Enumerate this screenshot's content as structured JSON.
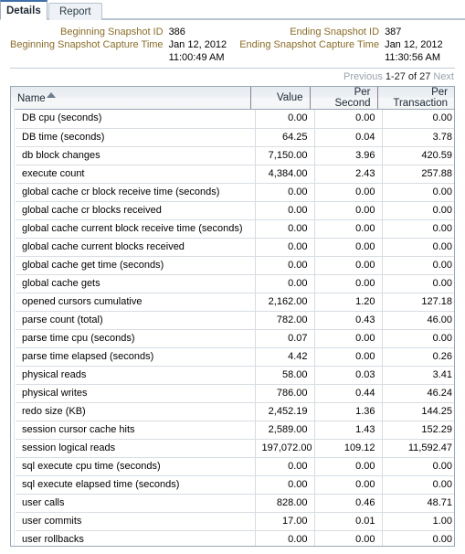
{
  "tabs": [
    {
      "label": "Details",
      "active": true
    },
    {
      "label": "Report",
      "active": false
    }
  ],
  "summary": {
    "beginning_snapshot_id_label": "Beginning Snapshot ID",
    "beginning_snapshot_id_value": "386",
    "beginning_capture_time_label": "Beginning Snapshot Capture Time",
    "beginning_capture_time_date": "Jan 12, 2012",
    "beginning_capture_time_clock": "11:00:49 AM",
    "ending_snapshot_id_label": "Ending Snapshot ID",
    "ending_snapshot_id_value": "387",
    "ending_capture_time_label": "Ending Snapshot Capture Time",
    "ending_capture_time_date": "Jan 12, 2012",
    "ending_capture_time_clock": "11:30:56 AM"
  },
  "pagination": {
    "previous_label": "Previous",
    "range_label": "1-27",
    "of_label": "of 27",
    "next_label": "Next"
  },
  "table": {
    "sort_column": "Name",
    "sort_direction": "ascending",
    "columns": [
      {
        "label": "Name",
        "align": "left"
      },
      {
        "label": "Value",
        "align": "right"
      },
      {
        "label": "Per Second",
        "align": "right"
      },
      {
        "label": "Per Transaction",
        "align": "right"
      }
    ],
    "rows": [
      {
        "name": "DB cpu (seconds)",
        "value": "0.00",
        "per_second": "0.00",
        "per_transaction": "0.00"
      },
      {
        "name": "DB time (seconds)",
        "value": "64.25",
        "per_second": "0.04",
        "per_transaction": "3.78"
      },
      {
        "name": "db block changes",
        "value": "7,150.00",
        "per_second": "3.96",
        "per_transaction": "420.59"
      },
      {
        "name": "execute count",
        "value": "4,384.00",
        "per_second": "2.43",
        "per_transaction": "257.88"
      },
      {
        "name": "global cache cr block receive time (seconds)",
        "value": "0.00",
        "per_second": "0.00",
        "per_transaction": "0.00"
      },
      {
        "name": "global cache cr blocks received",
        "value": "0.00",
        "per_second": "0.00",
        "per_transaction": "0.00"
      },
      {
        "name": "global cache current block receive time (seconds)",
        "value": "0.00",
        "per_second": "0.00",
        "per_transaction": "0.00"
      },
      {
        "name": "global cache current blocks received",
        "value": "0.00",
        "per_second": "0.00",
        "per_transaction": "0.00"
      },
      {
        "name": "global cache get time (seconds)",
        "value": "0.00",
        "per_second": "0.00",
        "per_transaction": "0.00"
      },
      {
        "name": "global cache gets",
        "value": "0.00",
        "per_second": "0.00",
        "per_transaction": "0.00"
      },
      {
        "name": "opened cursors cumulative",
        "value": "2,162.00",
        "per_second": "1.20",
        "per_transaction": "127.18"
      },
      {
        "name": "parse count (total)",
        "value": "782.00",
        "per_second": "0.43",
        "per_transaction": "46.00"
      },
      {
        "name": "parse time cpu (seconds)",
        "value": "0.07",
        "per_second": "0.00",
        "per_transaction": "0.00"
      },
      {
        "name": "parse time elapsed (seconds)",
        "value": "4.42",
        "per_second": "0.00",
        "per_transaction": "0.26"
      },
      {
        "name": "physical reads",
        "value": "58.00",
        "per_second": "0.03",
        "per_transaction": "3.41"
      },
      {
        "name": "physical writes",
        "value": "786.00",
        "per_second": "0.44",
        "per_transaction": "46.24"
      },
      {
        "name": "redo size (KB)",
        "value": "2,452.19",
        "per_second": "1.36",
        "per_transaction": "144.25"
      },
      {
        "name": "session cursor cache hits",
        "value": "2,589.00",
        "per_second": "1.43",
        "per_transaction": "152.29"
      },
      {
        "name": "session logical reads",
        "value": "197,072.00",
        "per_second": "109.12",
        "per_transaction": "11,592.47"
      },
      {
        "name": "sql execute cpu time (seconds)",
        "value": "0.00",
        "per_second": "0.00",
        "per_transaction": "0.00"
      },
      {
        "name": "sql execute elapsed time (seconds)",
        "value": "0.00",
        "per_second": "0.00",
        "per_transaction": "0.00"
      },
      {
        "name": "user calls",
        "value": "828.00",
        "per_second": "0.46",
        "per_transaction": "48.71"
      },
      {
        "name": "user commits",
        "value": "17.00",
        "per_second": "0.01",
        "per_transaction": "1.00"
      },
      {
        "name": "user rollbacks",
        "value": "0.00",
        "per_second": "0.00",
        "per_transaction": "0.00"
      }
    ]
  },
  "colors": {
    "label_brown": "#8a6d29",
    "tab_active_accent": "#3f6fa8",
    "grid_border": "#9aa8b5",
    "row_border": "#d8dde2",
    "link_muted": "#9aa3ad"
  }
}
